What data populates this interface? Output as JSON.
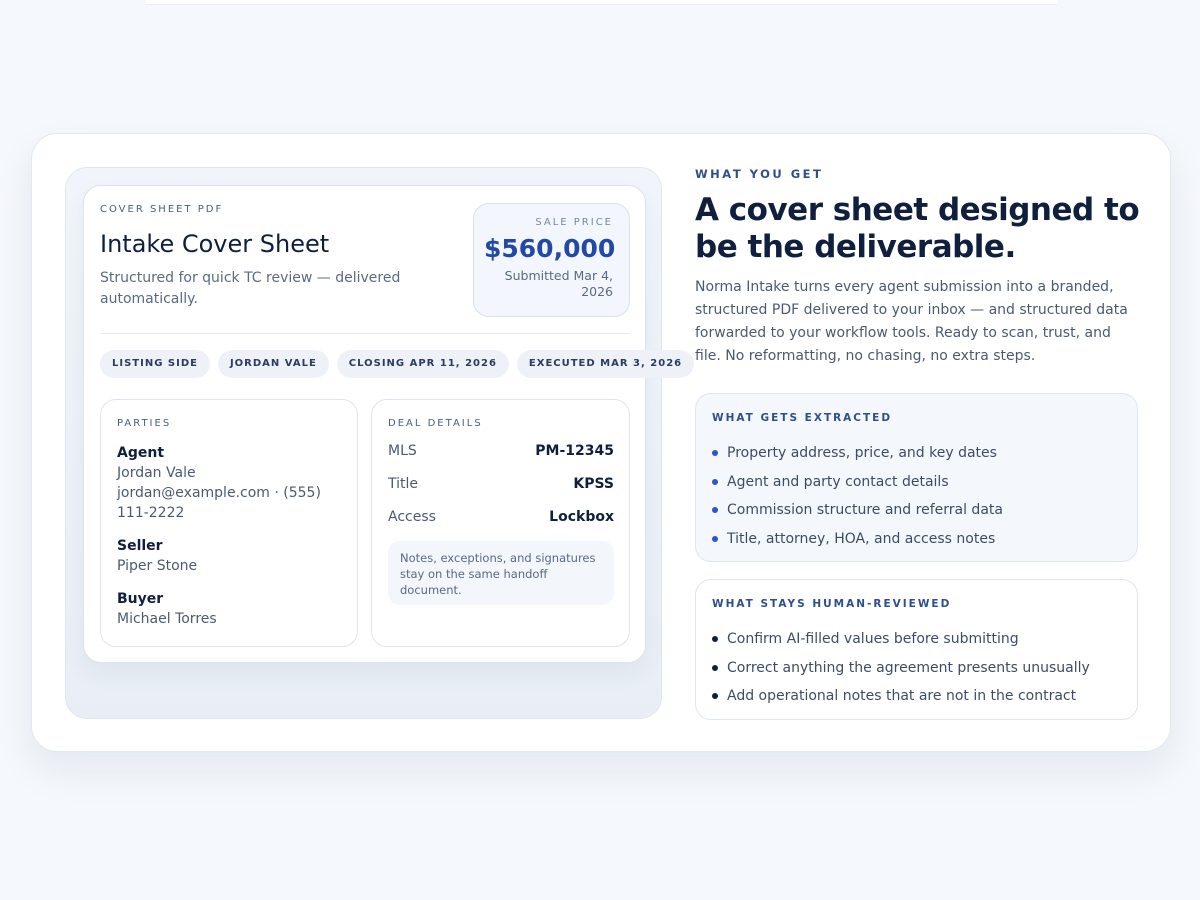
{
  "cover_sheet": {
    "eyebrow": "COVER SHEET PDF",
    "title": "Intake Cover Sheet",
    "subtitle": "Structured for quick TC review — delivered automatically.",
    "price": {
      "label": "SALE PRICE",
      "value": "$560,000",
      "submitted": "Submitted Mar 4, 2026"
    },
    "pills": [
      "LISTING SIDE",
      "JORDAN VALE",
      "CLOSING APR 11, 2026",
      "EXECUTED MAR 3, 2026"
    ],
    "parties": {
      "heading": "PARTIES",
      "agent_role": "Agent",
      "agent_name": "Jordan Vale",
      "agent_contact": "jordan@example.com · (555) 111-2222",
      "seller_role": "Seller",
      "seller_name": "Piper Stone",
      "buyer_role": "Buyer",
      "buyer_name": "Michael Torres"
    },
    "deal": {
      "heading": "DEAL DETAILS",
      "rows": [
        {
          "label": "MLS",
          "value": "PM-12345"
        },
        {
          "label": "Title",
          "value": "KPSS"
        },
        {
          "label": "Access",
          "value": "Lockbox"
        }
      ],
      "note": "Notes, exceptions, and signatures stay on the same handoff document."
    }
  },
  "right": {
    "eyebrow": "WHAT YOU GET",
    "title": "A cover sheet designed to be the deliverable.",
    "body": "Norma Intake turns every agent submission into a branded, structured PDF delivered to your inbox — and structured data forwarded to your workflow tools. Ready to scan, trust, and file. No reformatting, no chasing, no extra steps.",
    "extracted": {
      "heading": "WHAT GETS EXTRACTED",
      "items": [
        "Property address, price, and key dates",
        "Agent and party contact details",
        "Commission structure and referral data",
        "Title, attorney, HOA, and access notes"
      ]
    },
    "reviewed": {
      "heading": "WHAT STAYS HUMAN-REVIEWED",
      "items": [
        "Confirm AI-filled values before submitting",
        "Correct anything the agreement presents unusually",
        "Add operational notes that are not in the contract"
      ]
    }
  },
  "colors": {
    "accent": "#2349a7",
    "background": "#f5f8fc",
    "text_primary": "#0f1f3d"
  }
}
